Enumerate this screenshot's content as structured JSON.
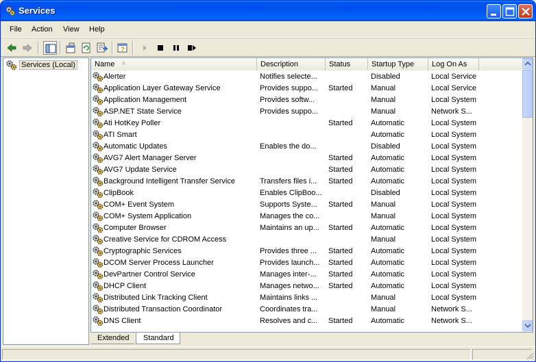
{
  "window": {
    "title": "Services",
    "app_icon": "gears-icon"
  },
  "menu": [
    "File",
    "Action",
    "View",
    "Help"
  ],
  "toolbar": [
    "back-arrow-icon",
    "forward-arrow-icon",
    "show-hide-tree-icon",
    "properties-icon",
    "refresh-icon",
    "export-list-icon",
    "help-icon",
    "start-service-icon",
    "stop-service-icon",
    "pause-service-icon",
    "restart-service-icon"
  ],
  "tree": {
    "root": "Services (Local)"
  },
  "columns": {
    "name": "Name",
    "description": "Description",
    "status": "Status",
    "startup": "Startup Type",
    "logon": "Log On As"
  },
  "services": [
    {
      "name": "Alerter",
      "description": "Notifies selecte...",
      "status": "",
      "startup": "Disabled",
      "logon": "Local Service"
    },
    {
      "name": "Application Layer Gateway Service",
      "description": "Provides suppo...",
      "status": "Started",
      "startup": "Manual",
      "logon": "Local Service"
    },
    {
      "name": "Application Management",
      "description": "Provides softw...",
      "status": "",
      "startup": "Manual",
      "logon": "Local System"
    },
    {
      "name": "ASP.NET State Service",
      "description": "Provides suppo...",
      "status": "",
      "startup": "Manual",
      "logon": "Network S..."
    },
    {
      "name": "Ati HotKey Poller",
      "description": "",
      "status": "Started",
      "startup": "Automatic",
      "logon": "Local System"
    },
    {
      "name": "ATI Smart",
      "description": "",
      "status": "",
      "startup": "Automatic",
      "logon": "Local System"
    },
    {
      "name": "Automatic Updates",
      "description": "Enables the do...",
      "status": "",
      "startup": "Disabled",
      "logon": "Local System"
    },
    {
      "name": "AVG7 Alert Manager Server",
      "description": "",
      "status": "Started",
      "startup": "Automatic",
      "logon": "Local System"
    },
    {
      "name": "AVG7 Update Service",
      "description": "",
      "status": "Started",
      "startup": "Automatic",
      "logon": "Local System"
    },
    {
      "name": "Background Intelligent Transfer Service",
      "description": "Transfers files i...",
      "status": "Started",
      "startup": "Automatic",
      "logon": "Local System"
    },
    {
      "name": "ClipBook",
      "description": "Enables ClipBoo...",
      "status": "",
      "startup": "Disabled",
      "logon": "Local System"
    },
    {
      "name": "COM+ Event System",
      "description": "Supports Syste...",
      "status": "Started",
      "startup": "Manual",
      "logon": "Local System"
    },
    {
      "name": "COM+ System Application",
      "description": "Manages the co...",
      "status": "",
      "startup": "Manual",
      "logon": "Local System"
    },
    {
      "name": "Computer Browser",
      "description": "Maintains an up...",
      "status": "Started",
      "startup": "Automatic",
      "logon": "Local System"
    },
    {
      "name": "Creative Service for CDROM Access",
      "description": "",
      "status": "",
      "startup": "Manual",
      "logon": "Local System"
    },
    {
      "name": "Cryptographic Services",
      "description": "Provides three ...",
      "status": "Started",
      "startup": "Automatic",
      "logon": "Local System"
    },
    {
      "name": "DCOM Server Process Launcher",
      "description": "Provides launch...",
      "status": "Started",
      "startup": "Automatic",
      "logon": "Local System"
    },
    {
      "name": "DevPartner Control Service",
      "description": "Manages inter-...",
      "status": "Started",
      "startup": "Automatic",
      "logon": "Local System"
    },
    {
      "name": "DHCP Client",
      "description": "Manages netwo...",
      "status": "Started",
      "startup": "Automatic",
      "logon": "Local System"
    },
    {
      "name": "Distributed Link Tracking Client",
      "description": "Maintains links ...",
      "status": "",
      "startup": "Manual",
      "logon": "Local System"
    },
    {
      "name": "Distributed Transaction Coordinator",
      "description": "Coordinates tra...",
      "status": "",
      "startup": "Manual",
      "logon": "Network S..."
    },
    {
      "name": "DNS Client",
      "description": "Resolves and c...",
      "status": "Started",
      "startup": "Automatic",
      "logon": "Network S..."
    }
  ],
  "tabs": [
    "Extended",
    "Standard"
  ],
  "active_tab": "Standard",
  "colors": {
    "titlebar": "#0053ee",
    "window_bg": "#ece9d8",
    "pane_border": "#7f9db9"
  }
}
